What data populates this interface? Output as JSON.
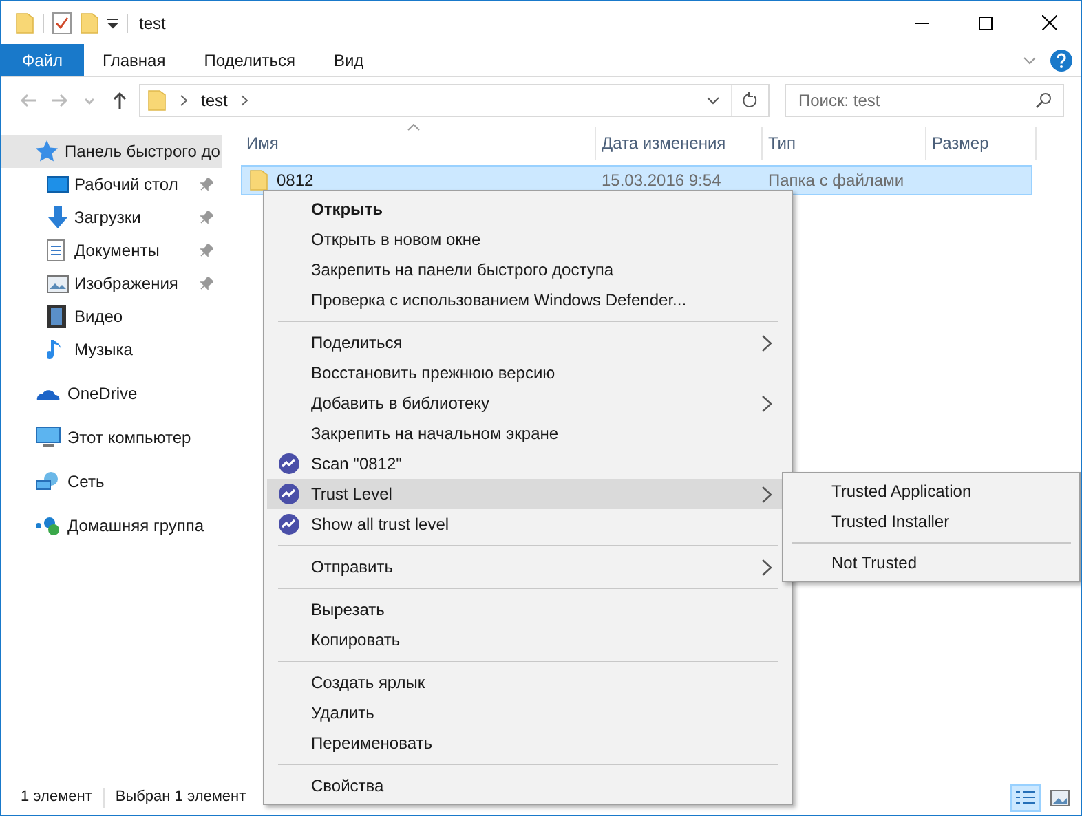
{
  "window": {
    "title": "test"
  },
  "ribbon_tabs": [
    {
      "label": "Файл",
      "kind": "file"
    },
    {
      "label": "Главная",
      "kind": "tab"
    },
    {
      "label": "Поделиться",
      "kind": "tab"
    },
    {
      "label": "Вид",
      "kind": "tab"
    }
  ],
  "address_bar": {
    "path": [
      "test"
    ]
  },
  "search": {
    "placeholder": "Поиск: test"
  },
  "sidebar": {
    "items": [
      {
        "label": "Панель быстрого до",
        "selected": true,
        "children": [
          {
            "label": "Рабочий стол",
            "pinned": true,
            "selected": false
          },
          {
            "label": "Загрузки",
            "pinned": true,
            "selected": false
          },
          {
            "label": "Документы",
            "pinned": true,
            "selected": false
          },
          {
            "label": "Изображения",
            "pinned": true,
            "selected": false
          },
          {
            "label": "Видео",
            "pinned": false,
            "selected": false
          },
          {
            "label": "Музыка",
            "pinned": false,
            "selected": false
          }
        ]
      },
      {
        "label": "OneDrive",
        "selected": false
      },
      {
        "label": "Этот компьютер",
        "selected": false
      },
      {
        "label": "Сеть",
        "selected": false
      },
      {
        "label": "Домашняя группа",
        "selected": false
      }
    ]
  },
  "table": {
    "columns": [
      "Имя",
      "Дата изменения",
      "Тип",
      "Размер"
    ],
    "rows": [
      {
        "name": "0812",
        "date": "15.03.2016 9:54",
        "type": "Папка с файлами",
        "selected": true
      }
    ]
  },
  "context_menu": {
    "items": [
      {
        "kind": "item",
        "label": "Открыть",
        "bold": true,
        "submenu": false,
        "selected": false
      },
      {
        "kind": "item",
        "label": "Открыть в новом окне",
        "bold": false,
        "submenu": false,
        "selected": false
      },
      {
        "kind": "item",
        "label": "Закрепить на панели быстрого доступа",
        "bold": false,
        "submenu": false,
        "selected": false
      },
      {
        "kind": "item",
        "label": "Проверка с использованием Windows Defender...",
        "bold": false,
        "submenu": false,
        "selected": false
      },
      {
        "kind": "separator"
      },
      {
        "kind": "item",
        "label": "Поделиться",
        "bold": false,
        "submenu": true,
        "selected": false
      },
      {
        "kind": "item",
        "label": "Восстановить прежнюю версию",
        "bold": false,
        "submenu": false,
        "selected": false
      },
      {
        "kind": "item",
        "label": "Добавить в библиотеку",
        "bold": false,
        "submenu": true,
        "selected": false
      },
      {
        "kind": "item",
        "label": "Закрепить на начальном экране",
        "bold": false,
        "submenu": false,
        "selected": false
      },
      {
        "kind": "app_item",
        "label": "Scan \"0812\"",
        "bold": false,
        "submenu": false,
        "selected": false
      },
      {
        "kind": "app_item",
        "label": "Trust Level",
        "bold": false,
        "submenu": true,
        "selected": true
      },
      {
        "kind": "app_item",
        "label": "Show all trust level",
        "bold": false,
        "submenu": false,
        "selected": false
      },
      {
        "kind": "separator"
      },
      {
        "kind": "item",
        "label": "Отправить",
        "bold": false,
        "submenu": true,
        "selected": false
      },
      {
        "kind": "separator"
      },
      {
        "kind": "item",
        "label": "Вырезать",
        "bold": false,
        "submenu": false,
        "selected": false
      },
      {
        "kind": "item",
        "label": "Копировать",
        "bold": false,
        "submenu": false,
        "selected": false
      },
      {
        "kind": "separator"
      },
      {
        "kind": "item",
        "label": "Создать ярлык",
        "bold": false,
        "submenu": false,
        "selected": false
      },
      {
        "kind": "item",
        "label": "Удалить",
        "bold": false,
        "submenu": false,
        "selected": false
      },
      {
        "kind": "item",
        "label": "Переименовать",
        "bold": false,
        "submenu": false,
        "selected": false
      },
      {
        "kind": "separator"
      },
      {
        "kind": "item",
        "label": "Свойства",
        "bold": false,
        "submenu": false,
        "selected": false
      }
    ]
  },
  "submenu": {
    "items": [
      {
        "kind": "item",
        "label": "Trusted Application"
      },
      {
        "kind": "item",
        "label": "Trusted Installer"
      },
      {
        "kind": "separator"
      },
      {
        "kind": "item",
        "label": "Not Trusted"
      }
    ]
  },
  "status_bar": {
    "item_count": "1 элемент",
    "selection": "Выбран 1 элемент"
  },
  "view_buttons": [
    {
      "selected": true
    },
    {
      "selected": false
    }
  ]
}
